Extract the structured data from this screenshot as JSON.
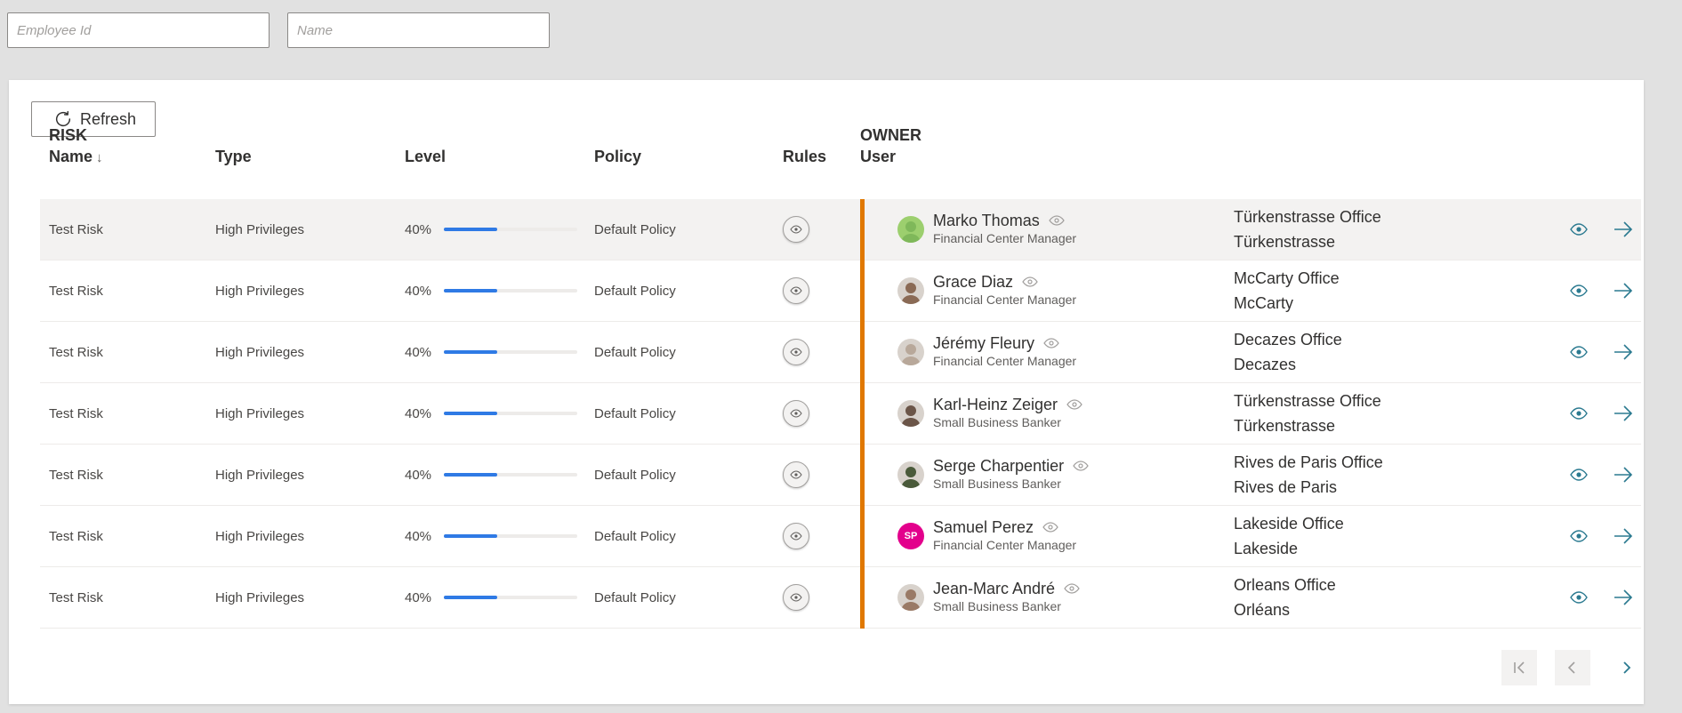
{
  "filters": {
    "employee_id_placeholder": "Employee Id",
    "name_placeholder": "Name"
  },
  "toolbar": {
    "refresh_label": "Refresh"
  },
  "headers": {
    "risk_group": "RISK",
    "name": "Name",
    "type": "Type",
    "level": "Level",
    "policy": "Policy",
    "rules": "Rules",
    "owner_group": "OWNER",
    "user": "User"
  },
  "colors": {
    "accent": "#e07800",
    "progress": "#2f7ae5",
    "link": "#2b7a90",
    "avatar_sp": "#e3008c"
  },
  "rows": [
    {
      "risk_name": "Test Risk",
      "type": "High Privileges",
      "level_text": "40%",
      "level": 0.4,
      "policy": "Default Policy",
      "user_name": "Marko Thomas",
      "user_role": "Financial Center Manager",
      "office": "Türkenstrasse Office",
      "location": "Türkenstrasse",
      "avatar": "photo",
      "avatar_initials": ""
    },
    {
      "risk_name": "Test Risk",
      "type": "High Privileges",
      "level_text": "40%",
      "level": 0.4,
      "policy": "Default Policy",
      "user_name": "Grace Diaz",
      "user_role": "Financial Center Manager",
      "office": "McCarty Office",
      "location": "McCarty",
      "avatar": "photo",
      "avatar_initials": ""
    },
    {
      "risk_name": "Test Risk",
      "type": "High Privileges",
      "level_text": "40%",
      "level": 0.4,
      "policy": "Default Policy",
      "user_name": "Jérémy Fleury",
      "user_role": "Financial Center Manager",
      "office": "Decazes Office",
      "location": "Decazes",
      "avatar": "photo",
      "avatar_initials": ""
    },
    {
      "risk_name": "Test Risk",
      "type": "High Privileges",
      "level_text": "40%",
      "level": 0.4,
      "policy": "Default Policy",
      "user_name": "Karl-Heinz Zeiger",
      "user_role": "Small Business Banker",
      "office": "Türkenstrasse Office",
      "location": "Türkenstrasse",
      "avatar": "photo",
      "avatar_initials": ""
    },
    {
      "risk_name": "Test Risk",
      "type": "High Privileges",
      "level_text": "40%",
      "level": 0.4,
      "policy": "Default Policy",
      "user_name": "Serge Charpentier",
      "user_role": "Small Business Banker",
      "office": "Rives de Paris Office",
      "location": "Rives de Paris",
      "avatar": "photo",
      "avatar_initials": ""
    },
    {
      "risk_name": "Test Risk",
      "type": "High Privileges",
      "level_text": "40%",
      "level": 0.4,
      "policy": "Default Policy",
      "user_name": "Samuel Perez",
      "user_role": "Financial Center Manager",
      "office": "Lakeside Office",
      "location": "Lakeside",
      "avatar": "initials",
      "avatar_initials": "SP"
    },
    {
      "risk_name": "Test Risk",
      "type": "High Privileges",
      "level_text": "40%",
      "level": 0.4,
      "policy": "Default Policy",
      "user_name": "Jean-Marc André",
      "user_role": "Small Business Banker",
      "office": "Orleans Office",
      "location": "Orléans",
      "avatar": "photo",
      "avatar_initials": ""
    }
  ],
  "pager": {
    "first_icon": "first-page-icon",
    "prev_icon": "chevron-left-icon",
    "next_icon": "chevron-right-icon"
  }
}
